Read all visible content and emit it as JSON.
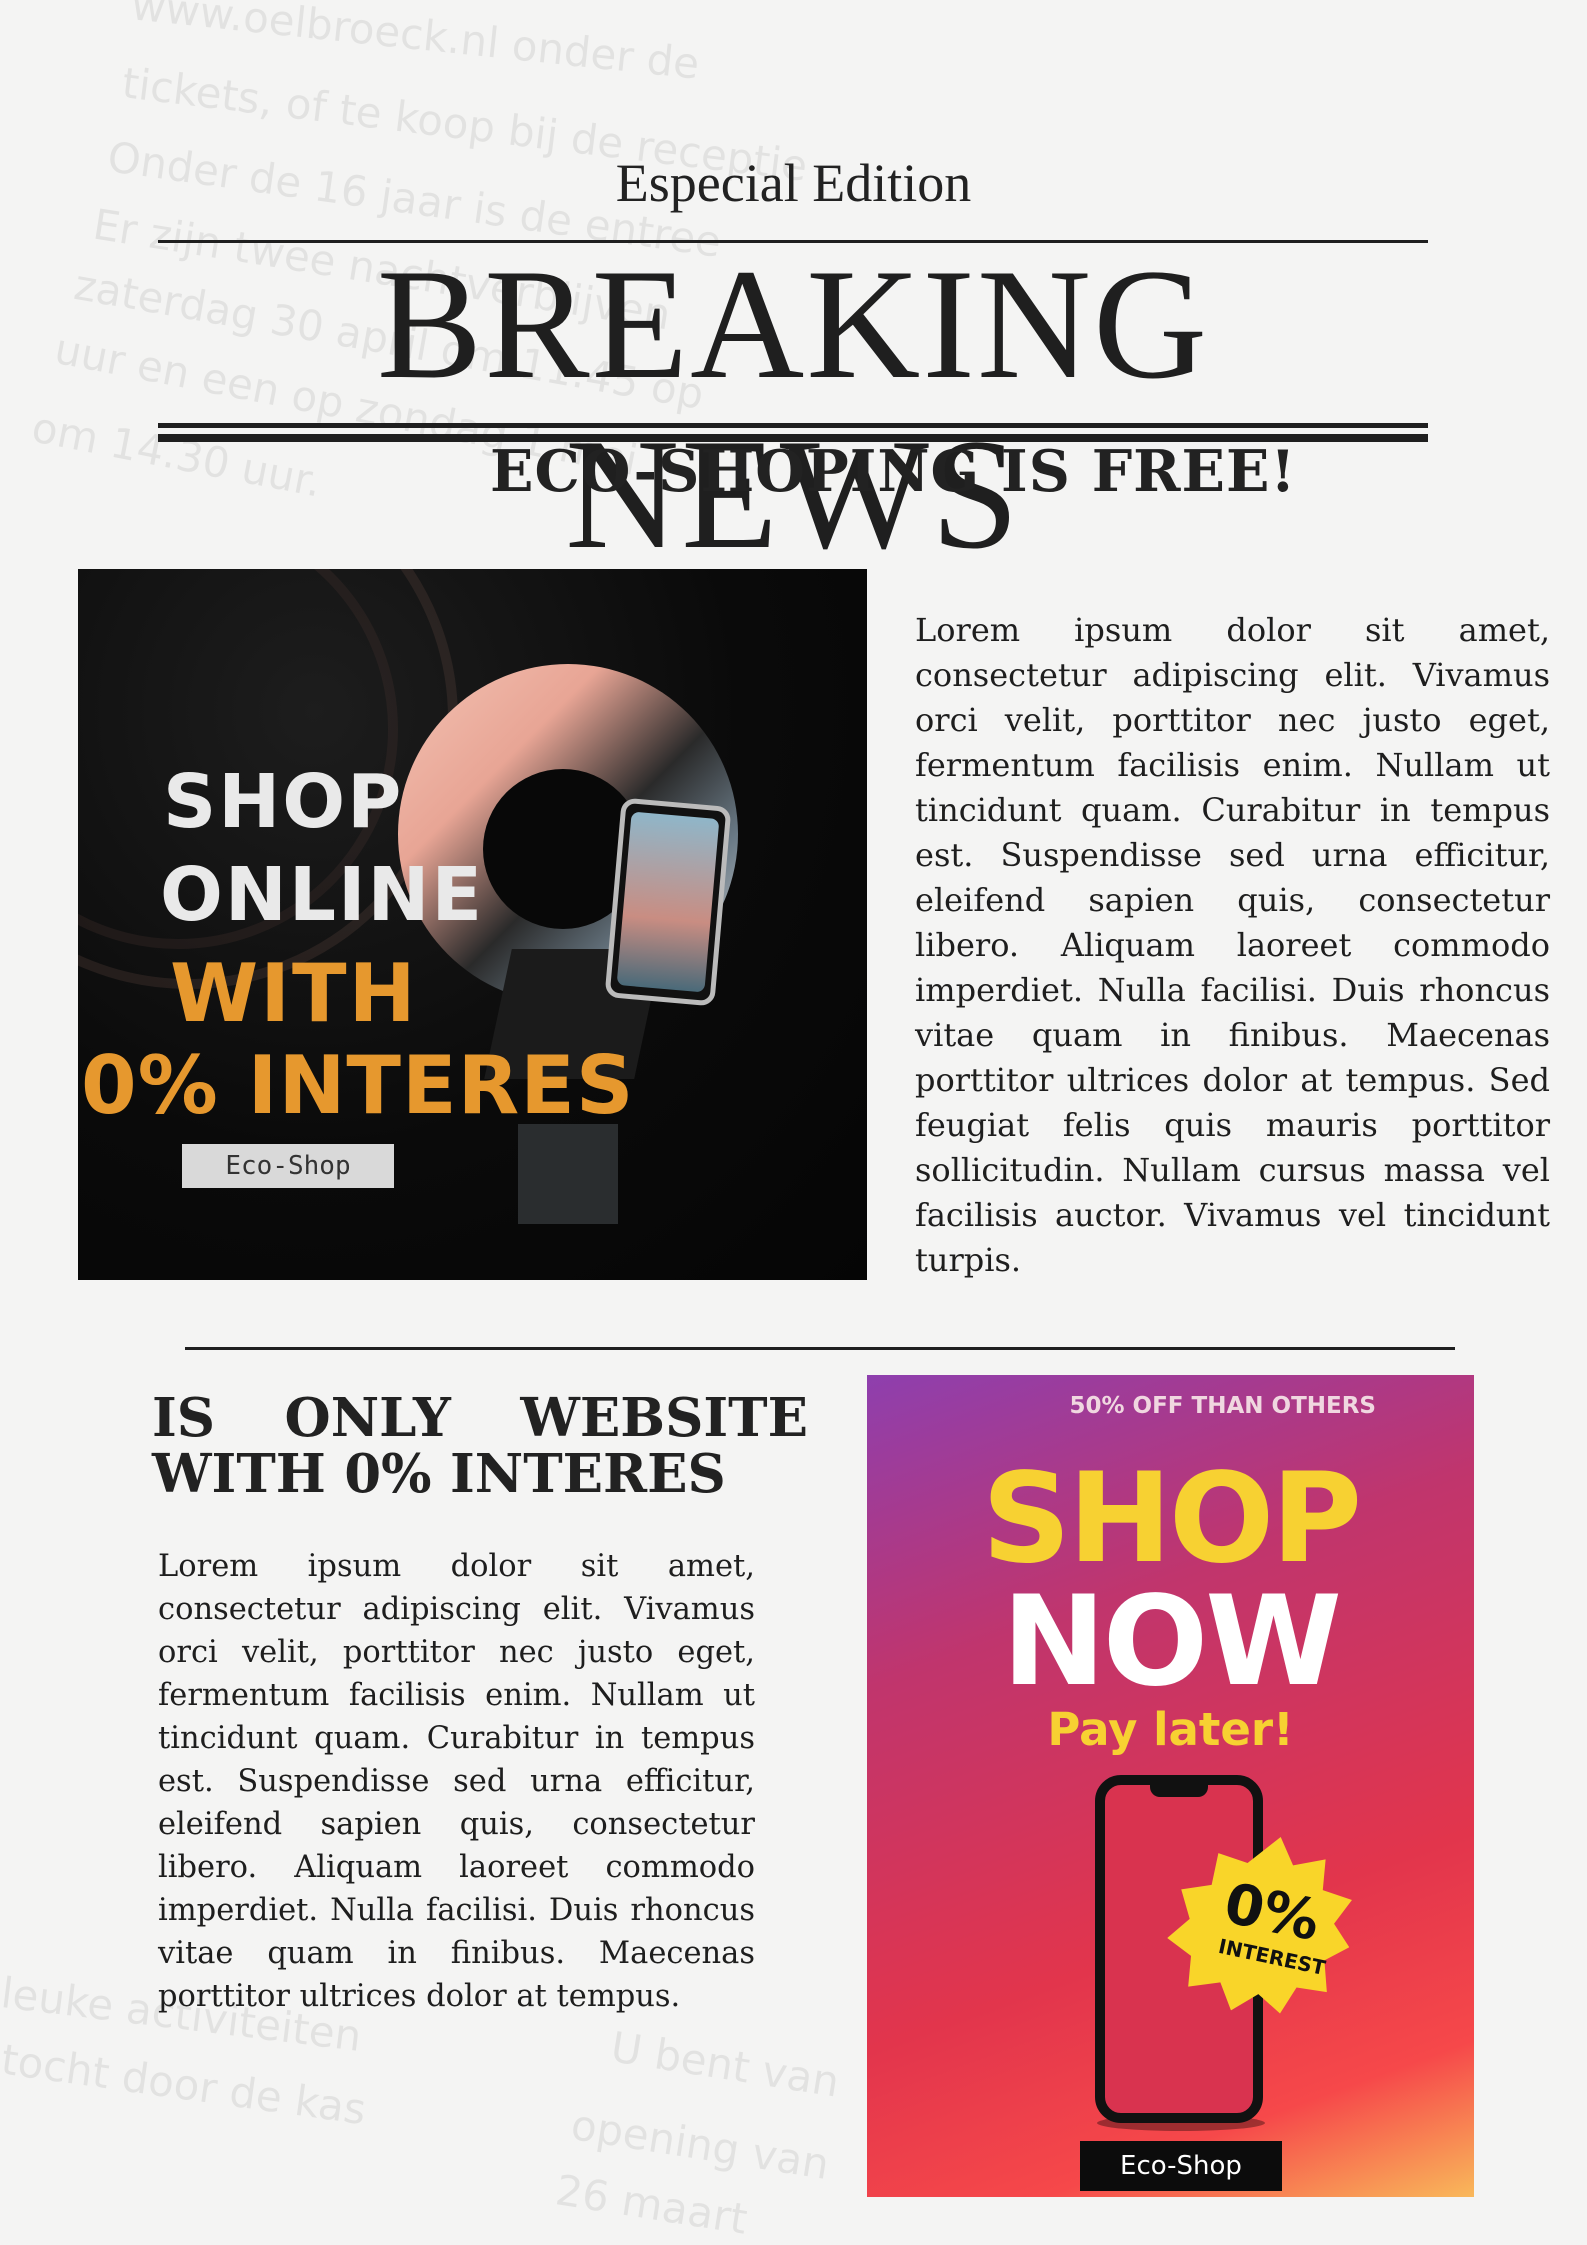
{
  "header": {
    "edition": "Especial Edition",
    "headline": "BREAKING NEWS",
    "subheadline": "ECO-SHOPING IS FREE!"
  },
  "section1": {
    "ad": {
      "line1": "SHOP",
      "line2": "ONLINE",
      "line3": "WITH",
      "line4": "0% INTERES",
      "badge": "Eco-Shop"
    },
    "body": "Lorem ipsum dolor sit amet, consectetur adipiscing elit. Vivamus orci velit, porttitor nec justo eget, fermentum facilisis enim. Nullam ut tincidunt quam. Curabitur in tempus est. Suspendisse sed urna efficitur, eleifend sapien quis, consectetur libero. Aliquam laoreet commodo imperdiet. Nulla facilisi. Duis rhoncus vitae quam in finibus. Maecenas porttitor ultrices dolor at tempus. Sed feugiat felis quis mauris porttitor sollicitudin. Nullam cursus massa vel facilisis auctor. Vivamus vel tincidunt turpis."
  },
  "section2": {
    "heading_line1": "IS ONLY WEBSITE",
    "heading_line2": "WITH 0% INTERES",
    "body": "Lorem ipsum dolor sit amet, consectetur adipiscing elit. Vivamus orci velit, porttitor nec justo eget, fermentum facilisis enim. Nullam ut tincidunt quam. Curabitur in tempus est. Suspendisse sed urna efficitur, eleifend sapien quis, consectetur libero. Aliquam laoreet commodo imperdiet. Nulla facilisi. Duis rhoncus vitae quam in finibus. Maecenas porttitor ultrices dolor at tempus.",
    "ad": {
      "top_text": "50% OFF THAN OTHERS",
      "shop": "SHOP",
      "now": "NOW",
      "pay_later": "Pay later!",
      "burst_value": "0%",
      "burst_label": "INTEREST",
      "badge": "Eco-Shop"
    }
  },
  "background_text": [
    "www.oelbroeck.nl onder de",
    "tickets, of te koop bij de receptie",
    "Onder de 16 jaar is de entree",
    "Er zijn twee nachtverblijven",
    "zaterdag 30 april om 11.45 op",
    "uur en een op zondag 1 mei",
    "om 14.30 uur.",
    "tocht door de kas",
    "opening van",
    "26 maart",
    "U bent van",
    "leuke activiteiten"
  ],
  "colors": {
    "ink": "#1f1f1f",
    "ad1_accent": "#e6982e",
    "ad2_yellow": "#f7d132"
  }
}
